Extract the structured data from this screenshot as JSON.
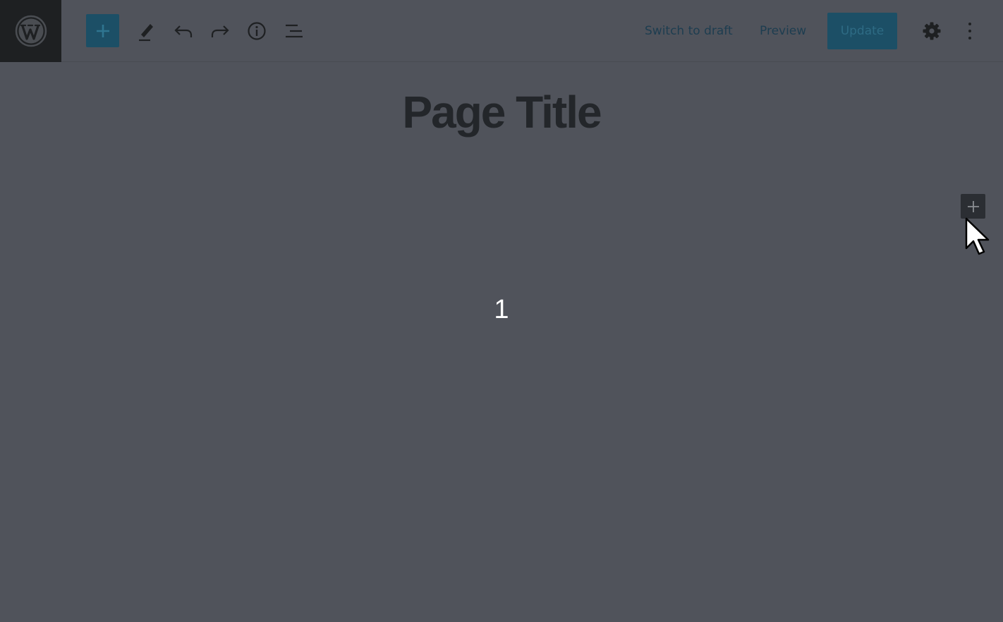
{
  "header": {
    "logo_icon": "wordpress-logo-icon",
    "inserter_icon": "plus-icon",
    "tools": [
      {
        "name": "edit-tool",
        "icon": "pencil-icon"
      },
      {
        "name": "undo",
        "icon": "undo-icon"
      },
      {
        "name": "redo",
        "icon": "redo-icon"
      },
      {
        "name": "details",
        "icon": "info-icon"
      },
      {
        "name": "list-view",
        "icon": "list-view-icon"
      }
    ],
    "switch_to_draft_label": "Switch to draft",
    "preview_label": "Preview",
    "update_label": "Update",
    "settings_icon": "gear-icon",
    "more_icon": "more-vertical-icon"
  },
  "editor": {
    "title": "Page Title",
    "block_add_icon": "plus-icon",
    "counter_text": "1"
  },
  "colors": {
    "overlay_background": "#50535b",
    "primary_button": "#1c4f66",
    "title_text": "#23262a",
    "link_text": "#1d3d50"
  }
}
